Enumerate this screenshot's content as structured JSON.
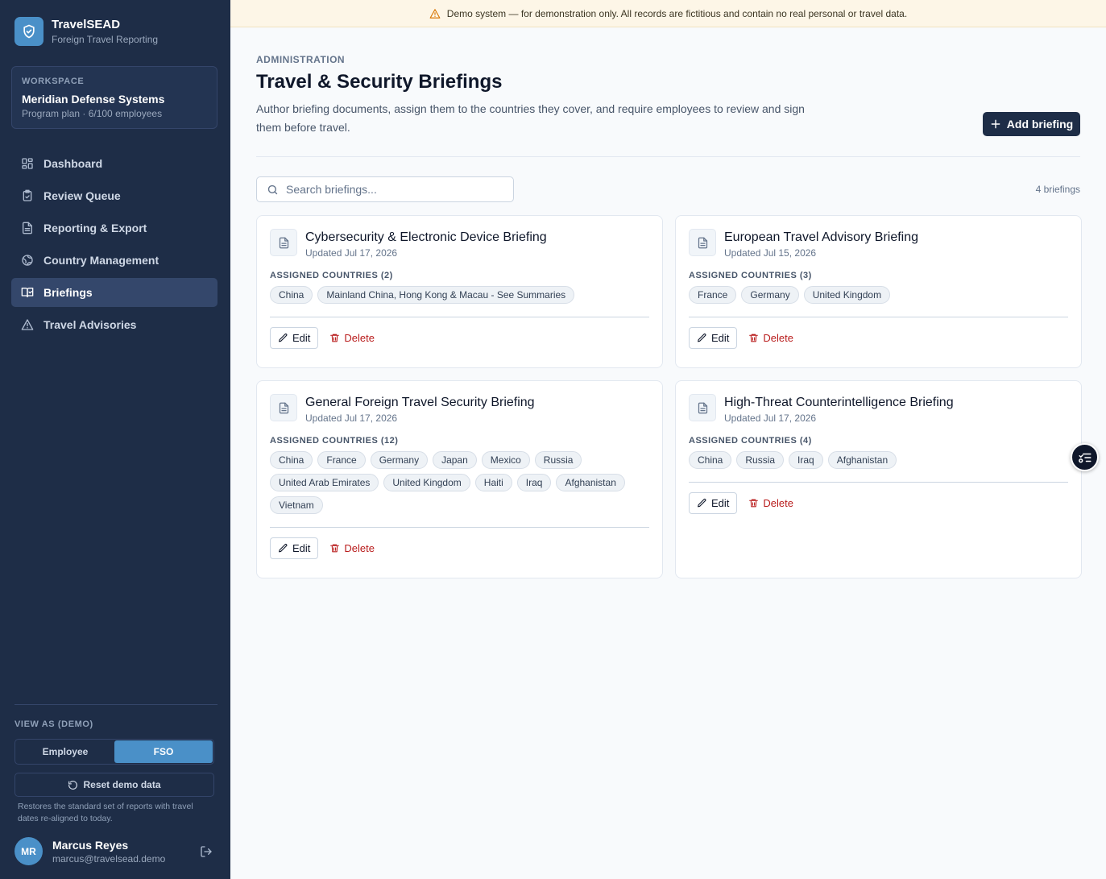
{
  "brand": {
    "title": "TravelSEAD",
    "subtitle": "Foreign Travel Reporting",
    "logo_icon": "shield-check-icon"
  },
  "workspace": {
    "label": "WORKSPACE",
    "name": "Meridian Defense Systems",
    "plan": "Program plan · 6/100 employees"
  },
  "nav": [
    {
      "label": "Dashboard",
      "icon": "dashboard-icon",
      "active": false
    },
    {
      "label": "Review Queue",
      "icon": "clipboard-check-icon",
      "active": false
    },
    {
      "label": "Reporting & Export",
      "icon": "file-icon",
      "active": false
    },
    {
      "label": "Country Management",
      "icon": "globe-icon",
      "active": false
    },
    {
      "label": "Briefings",
      "icon": "book-check-icon",
      "active": true
    },
    {
      "label": "Travel Advisories",
      "icon": "warning-icon",
      "active": false
    }
  ],
  "view_as": {
    "label": "VIEW AS (DEMO)",
    "options": [
      "Employee",
      "FSO"
    ],
    "selected": "FSO"
  },
  "reset": {
    "label": "Reset demo data",
    "note": "Restores the standard set of reports with travel dates re-aligned to today."
  },
  "user": {
    "initials": "MR",
    "name": "Marcus Reyes",
    "email": "marcus@travelsead.demo"
  },
  "banner": {
    "text": "Demo system — for demonstration only. All records are fictitious and contain no real personal or travel data."
  },
  "page": {
    "eyebrow": "ADMINISTRATION",
    "title": "Travel & Security Briefings",
    "description": "Author briefing documents, assign them to the countries they cover, and require employees to review and sign them before travel.",
    "add_button": "Add briefing"
  },
  "search": {
    "placeholder": "Search briefings...",
    "value": ""
  },
  "count_text": "4 briefings",
  "briefings": [
    {
      "title": "Cybersecurity & Electronic Device Briefing",
      "updated": "Updated Jul 17, 2026",
      "assigned_label": "ASSIGNED COUNTRIES (2)",
      "countries": [
        "China",
        "Mainland China, Hong Kong & Macau - See Summaries"
      ]
    },
    {
      "title": "European Travel Advisory Briefing",
      "updated": "Updated Jul 15, 2026",
      "assigned_label": "ASSIGNED COUNTRIES (3)",
      "countries": [
        "France",
        "Germany",
        "United Kingdom"
      ]
    },
    {
      "title": "General Foreign Travel Security Briefing",
      "updated": "Updated Jul 17, 2026",
      "assigned_label": "ASSIGNED COUNTRIES (12)",
      "countries": [
        "China",
        "France",
        "Germany",
        "Japan",
        "Mexico",
        "Russia",
        "United Arab Emirates",
        "United Kingdom",
        "Haiti",
        "Iraq",
        "Afghanistan",
        "Vietnam"
      ]
    },
    {
      "title": "High-Threat Counterintelligence Briefing",
      "updated": "Updated Jul 17, 2026",
      "assigned_label": "ASSIGNED COUNTRIES (4)",
      "countries": [
        "China",
        "Russia",
        "Iraq",
        "Afghanistan"
      ]
    }
  ],
  "card_actions": {
    "edit": "Edit",
    "delete": "Delete"
  },
  "colors": {
    "sidebar_bg": "#1e2d47",
    "accent": "#4a90c8",
    "danger": "#b91c1c",
    "banner_bg": "#fdf6e7"
  }
}
